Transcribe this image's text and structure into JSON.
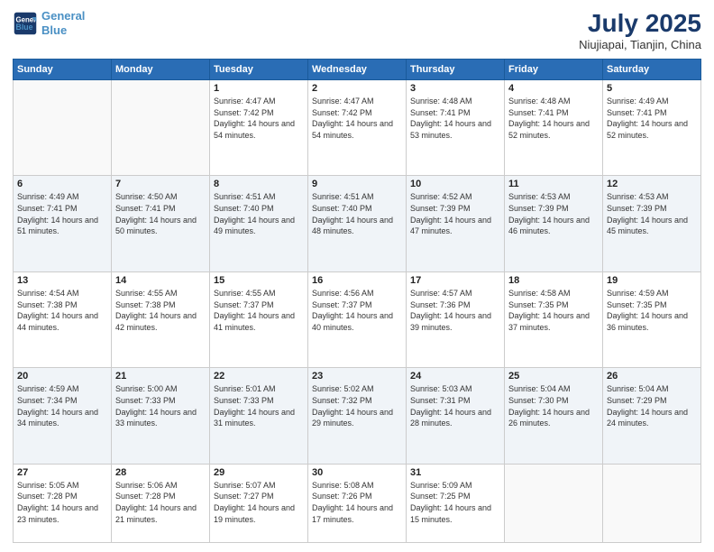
{
  "header": {
    "logo_line1": "General",
    "logo_line2": "Blue",
    "title": "July 2025",
    "subtitle": "Niujiapai, Tianjin, China"
  },
  "weekdays": [
    "Sunday",
    "Monday",
    "Tuesday",
    "Wednesday",
    "Thursday",
    "Friday",
    "Saturday"
  ],
  "weeks": [
    [
      {
        "day": "",
        "sunrise": "",
        "sunset": "",
        "daylight": ""
      },
      {
        "day": "",
        "sunrise": "",
        "sunset": "",
        "daylight": ""
      },
      {
        "day": "1",
        "sunrise": "Sunrise: 4:47 AM",
        "sunset": "Sunset: 7:42 PM",
        "daylight": "Daylight: 14 hours and 54 minutes."
      },
      {
        "day": "2",
        "sunrise": "Sunrise: 4:47 AM",
        "sunset": "Sunset: 7:42 PM",
        "daylight": "Daylight: 14 hours and 54 minutes."
      },
      {
        "day": "3",
        "sunrise": "Sunrise: 4:48 AM",
        "sunset": "Sunset: 7:41 PM",
        "daylight": "Daylight: 14 hours and 53 minutes."
      },
      {
        "day": "4",
        "sunrise": "Sunrise: 4:48 AM",
        "sunset": "Sunset: 7:41 PM",
        "daylight": "Daylight: 14 hours and 52 minutes."
      },
      {
        "day": "5",
        "sunrise": "Sunrise: 4:49 AM",
        "sunset": "Sunset: 7:41 PM",
        "daylight": "Daylight: 14 hours and 52 minutes."
      }
    ],
    [
      {
        "day": "6",
        "sunrise": "Sunrise: 4:49 AM",
        "sunset": "Sunset: 7:41 PM",
        "daylight": "Daylight: 14 hours and 51 minutes."
      },
      {
        "day": "7",
        "sunrise": "Sunrise: 4:50 AM",
        "sunset": "Sunset: 7:41 PM",
        "daylight": "Daylight: 14 hours and 50 minutes."
      },
      {
        "day": "8",
        "sunrise": "Sunrise: 4:51 AM",
        "sunset": "Sunset: 7:40 PM",
        "daylight": "Daylight: 14 hours and 49 minutes."
      },
      {
        "day": "9",
        "sunrise": "Sunrise: 4:51 AM",
        "sunset": "Sunset: 7:40 PM",
        "daylight": "Daylight: 14 hours and 48 minutes."
      },
      {
        "day": "10",
        "sunrise": "Sunrise: 4:52 AM",
        "sunset": "Sunset: 7:39 PM",
        "daylight": "Daylight: 14 hours and 47 minutes."
      },
      {
        "day": "11",
        "sunrise": "Sunrise: 4:53 AM",
        "sunset": "Sunset: 7:39 PM",
        "daylight": "Daylight: 14 hours and 46 minutes."
      },
      {
        "day": "12",
        "sunrise": "Sunrise: 4:53 AM",
        "sunset": "Sunset: 7:39 PM",
        "daylight": "Daylight: 14 hours and 45 minutes."
      }
    ],
    [
      {
        "day": "13",
        "sunrise": "Sunrise: 4:54 AM",
        "sunset": "Sunset: 7:38 PM",
        "daylight": "Daylight: 14 hours and 44 minutes."
      },
      {
        "day": "14",
        "sunrise": "Sunrise: 4:55 AM",
        "sunset": "Sunset: 7:38 PM",
        "daylight": "Daylight: 14 hours and 42 minutes."
      },
      {
        "day": "15",
        "sunrise": "Sunrise: 4:55 AM",
        "sunset": "Sunset: 7:37 PM",
        "daylight": "Daylight: 14 hours and 41 minutes."
      },
      {
        "day": "16",
        "sunrise": "Sunrise: 4:56 AM",
        "sunset": "Sunset: 7:37 PM",
        "daylight": "Daylight: 14 hours and 40 minutes."
      },
      {
        "day": "17",
        "sunrise": "Sunrise: 4:57 AM",
        "sunset": "Sunset: 7:36 PM",
        "daylight": "Daylight: 14 hours and 39 minutes."
      },
      {
        "day": "18",
        "sunrise": "Sunrise: 4:58 AM",
        "sunset": "Sunset: 7:35 PM",
        "daylight": "Daylight: 14 hours and 37 minutes."
      },
      {
        "day": "19",
        "sunrise": "Sunrise: 4:59 AM",
        "sunset": "Sunset: 7:35 PM",
        "daylight": "Daylight: 14 hours and 36 minutes."
      }
    ],
    [
      {
        "day": "20",
        "sunrise": "Sunrise: 4:59 AM",
        "sunset": "Sunset: 7:34 PM",
        "daylight": "Daylight: 14 hours and 34 minutes."
      },
      {
        "day": "21",
        "sunrise": "Sunrise: 5:00 AM",
        "sunset": "Sunset: 7:33 PM",
        "daylight": "Daylight: 14 hours and 33 minutes."
      },
      {
        "day": "22",
        "sunrise": "Sunrise: 5:01 AM",
        "sunset": "Sunset: 7:33 PM",
        "daylight": "Daylight: 14 hours and 31 minutes."
      },
      {
        "day": "23",
        "sunrise": "Sunrise: 5:02 AM",
        "sunset": "Sunset: 7:32 PM",
        "daylight": "Daylight: 14 hours and 29 minutes."
      },
      {
        "day": "24",
        "sunrise": "Sunrise: 5:03 AM",
        "sunset": "Sunset: 7:31 PM",
        "daylight": "Daylight: 14 hours and 28 minutes."
      },
      {
        "day": "25",
        "sunrise": "Sunrise: 5:04 AM",
        "sunset": "Sunset: 7:30 PM",
        "daylight": "Daylight: 14 hours and 26 minutes."
      },
      {
        "day": "26",
        "sunrise": "Sunrise: 5:04 AM",
        "sunset": "Sunset: 7:29 PM",
        "daylight": "Daylight: 14 hours and 24 minutes."
      }
    ],
    [
      {
        "day": "27",
        "sunrise": "Sunrise: 5:05 AM",
        "sunset": "Sunset: 7:28 PM",
        "daylight": "Daylight: 14 hours and 23 minutes."
      },
      {
        "day": "28",
        "sunrise": "Sunrise: 5:06 AM",
        "sunset": "Sunset: 7:28 PM",
        "daylight": "Daylight: 14 hours and 21 minutes."
      },
      {
        "day": "29",
        "sunrise": "Sunrise: 5:07 AM",
        "sunset": "Sunset: 7:27 PM",
        "daylight": "Daylight: 14 hours and 19 minutes."
      },
      {
        "day": "30",
        "sunrise": "Sunrise: 5:08 AM",
        "sunset": "Sunset: 7:26 PM",
        "daylight": "Daylight: 14 hours and 17 minutes."
      },
      {
        "day": "31",
        "sunrise": "Sunrise: 5:09 AM",
        "sunset": "Sunset: 7:25 PM",
        "daylight": "Daylight: 14 hours and 15 minutes."
      },
      {
        "day": "",
        "sunrise": "",
        "sunset": "",
        "daylight": ""
      },
      {
        "day": "",
        "sunrise": "",
        "sunset": "",
        "daylight": ""
      }
    ]
  ]
}
